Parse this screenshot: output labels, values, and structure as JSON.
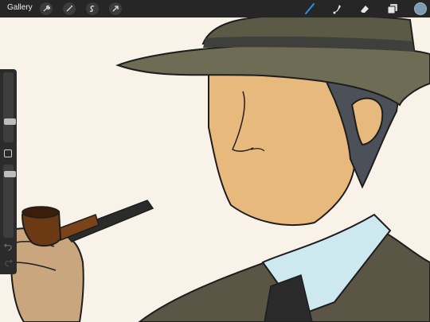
{
  "app": {
    "gallery_label": "Gallery"
  },
  "toolbar": {
    "left_tools": [
      {
        "name": "actions-wrench-icon"
      },
      {
        "name": "adjustments-wand-icon"
      },
      {
        "name": "selection-icon"
      },
      {
        "name": "transform-arrow-icon"
      }
    ],
    "right_tools": [
      {
        "name": "brush-icon",
        "active": true
      },
      {
        "name": "smudge-icon",
        "active": false
      },
      {
        "name": "eraser-icon",
        "active": false
      },
      {
        "name": "layers-icon",
        "active": false
      }
    ],
    "current_color": "#7e9bb2",
    "active_color": "#2f8fea"
  },
  "sidebar": {
    "brush_size_level": 0.42,
    "opacity_level": 0.82
  },
  "artwork": {
    "subject": "man-in-fedora-with-pipe",
    "colors": {
      "canvas": "#f8f2e8",
      "skin": "#e8b97d",
      "hat": "#5b5a47",
      "hat_band": "#3f3f3b",
      "hair": "#4c5058",
      "suit": "#5a5545",
      "shirt": "#cde9ef",
      "tie": "#2a2a2a",
      "pipe_bowl": "#6b3a14",
      "pipe_stem": "#2b2b2b",
      "hand": "#c9a67d",
      "outline": "#1e1e1e"
    }
  }
}
